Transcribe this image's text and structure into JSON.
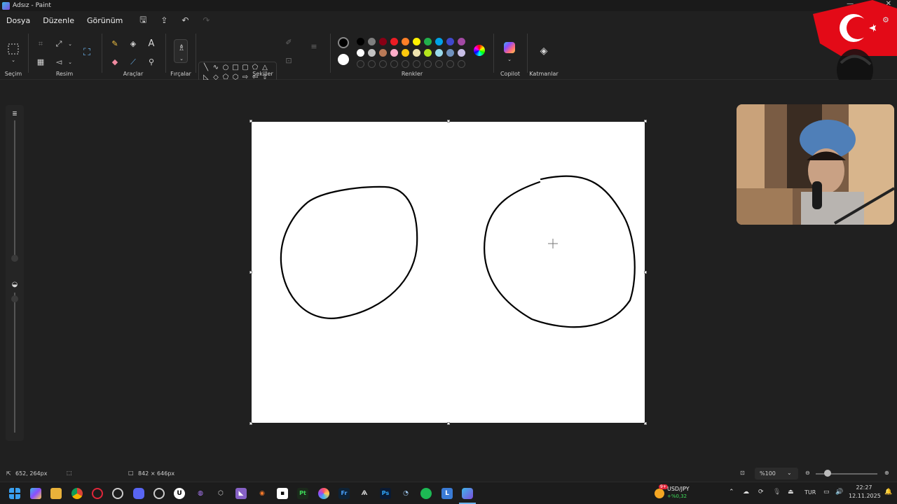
{
  "window": {
    "title": "Adsız - Paint",
    "minimize": "—",
    "restore": "▭",
    "close": "✕"
  },
  "menu": {
    "items": [
      "Dosya",
      "Düzenle",
      "Görünüm"
    ]
  },
  "ribbon": {
    "groups": {
      "selection": "Seçim",
      "image": "Resim",
      "tools": "Araçlar",
      "brushes": "Fırçalar",
      "shapes": "Şekiller",
      "colors": "Renkler",
      "copilot": "Copilot",
      "layers": "Katmanlar"
    },
    "text_tool_glyph": "A"
  },
  "palette": {
    "primary": "#000000",
    "secondary": "#ffffff",
    "row1": [
      "#000000",
      "#7f7f7f",
      "#880015",
      "#ed1c24",
      "#ff7f27",
      "#fff200",
      "#22b14c",
      "#00a2e8",
      "#3f48cc",
      "#a349a4"
    ],
    "row2": [
      "#ffffff",
      "#c3c3c3",
      "#b97a57",
      "#ffaec9",
      "#ffc90e",
      "#efe4b0",
      "#b5e61d",
      "#99d9ea",
      "#7092be",
      "#c8bfe7"
    ]
  },
  "status": {
    "cursor_position": "652, 264px",
    "canvas_size": "842 × 646px",
    "zoom": "%100"
  },
  "taskbar": {
    "ticker_name": "USD/JPY",
    "ticker_change": "+%0,32",
    "ticker_badge": "9+",
    "language": "TUR",
    "time": "22:27",
    "date": "12.11.2025"
  }
}
